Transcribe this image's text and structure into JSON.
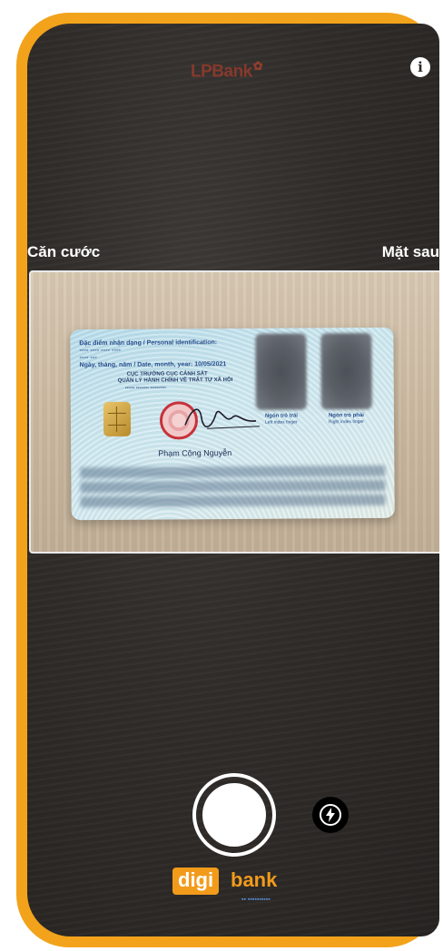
{
  "header": {
    "brand": "LPBank",
    "info_icon": "info-icon"
  },
  "labels": {
    "left": "Căn cước",
    "right": "Mặt sau"
  },
  "id_card": {
    "identification_title": "Đặc điểm nhận dạng / Personal identification:",
    "date_line": "Ngày, tháng, năm / Date, month, year: 10/05/2021",
    "authority_1": "CỤC TRƯỞNG CỤC CẢNH SÁT",
    "authority_2": "QUẢN LÝ HÀNH CHÍNH VỀ TRẬT TỰ XÃ HỘI",
    "holder_name": "Phạm Công Nguyễn",
    "left_finger_label": "Ngón trỏ trái",
    "left_finger_sub": "Left index finger",
    "right_finger_label": "Ngón trỏ phải",
    "right_finger_sub": "Right index finger"
  },
  "controls": {
    "shutter": "capture-button",
    "flash": "flash-icon"
  },
  "footer": {
    "logo_part1": "digi",
    "logo_part2": "bank"
  },
  "colors": {
    "frame": "#f2a31b",
    "brand": "#c8402a",
    "background": "#2e2a28",
    "logo": "#f29b1b"
  }
}
